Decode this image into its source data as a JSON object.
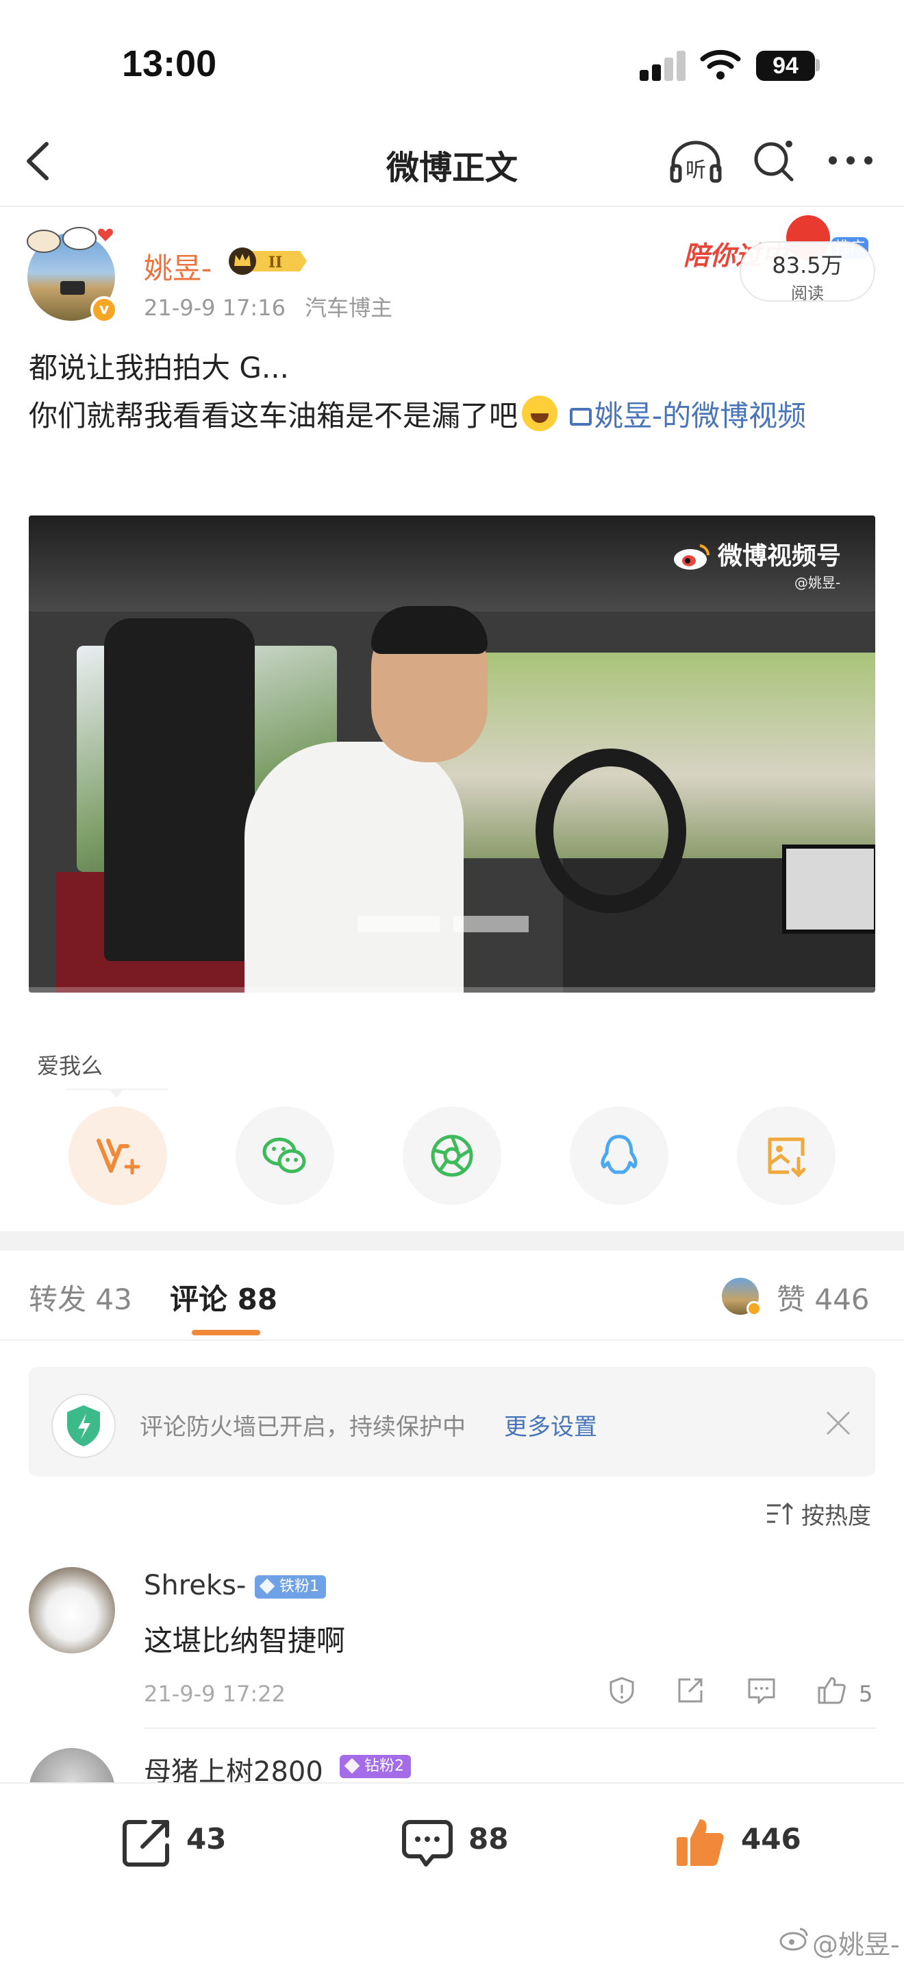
{
  "status_bar": {
    "time": "13:00",
    "battery": "94"
  },
  "nav": {
    "title": "微博正文"
  },
  "author": {
    "name": "姚昱-",
    "time": "21-9-9 17:16",
    "role": "汽车博主",
    "verified_mark": "v"
  },
  "promo": {
    "text": "陪你过中",
    "tag": "推广",
    "read_count": "83.5万",
    "read_label": "阅读"
  },
  "post": {
    "line1": "都说让我拍拍大 G...",
    "line2": "你们就帮我看看这车油箱是不是漏了吧",
    "video_link": "姚昱-的微博视频"
  },
  "video": {
    "watermark": "微博视频号",
    "watermark_sub": "@姚昱-"
  },
  "share": {
    "caption": "爱我么",
    "items": [
      "v-plus-icon",
      "wechat-icon",
      "moments-icon",
      "qq-icon",
      "save-image-icon"
    ]
  },
  "tabs": {
    "repost_label": "转发 43",
    "comment_label": "评论 88",
    "like_label": "赞 446"
  },
  "notice": {
    "text": "评论防火墙已开启，持续保护中",
    "link": "更多设置"
  },
  "sort": {
    "label": "按热度"
  },
  "comments": [
    {
      "user": "Shreks-",
      "badge": "铁粉1",
      "text": "这堪比纳智捷啊",
      "time": "21-9-9 17:22",
      "likes": "5"
    },
    {
      "user": "母猪上树2800",
      "badge": "钻粉2"
    }
  ],
  "bottom_bar": {
    "reposts": "43",
    "comments": "88",
    "likes": "446"
  },
  "footer": {
    "watermark": "@姚昱-"
  },
  "colors": {
    "accent": "#eb7340",
    "link": "#4a74b8",
    "like": "#f08a3a"
  }
}
